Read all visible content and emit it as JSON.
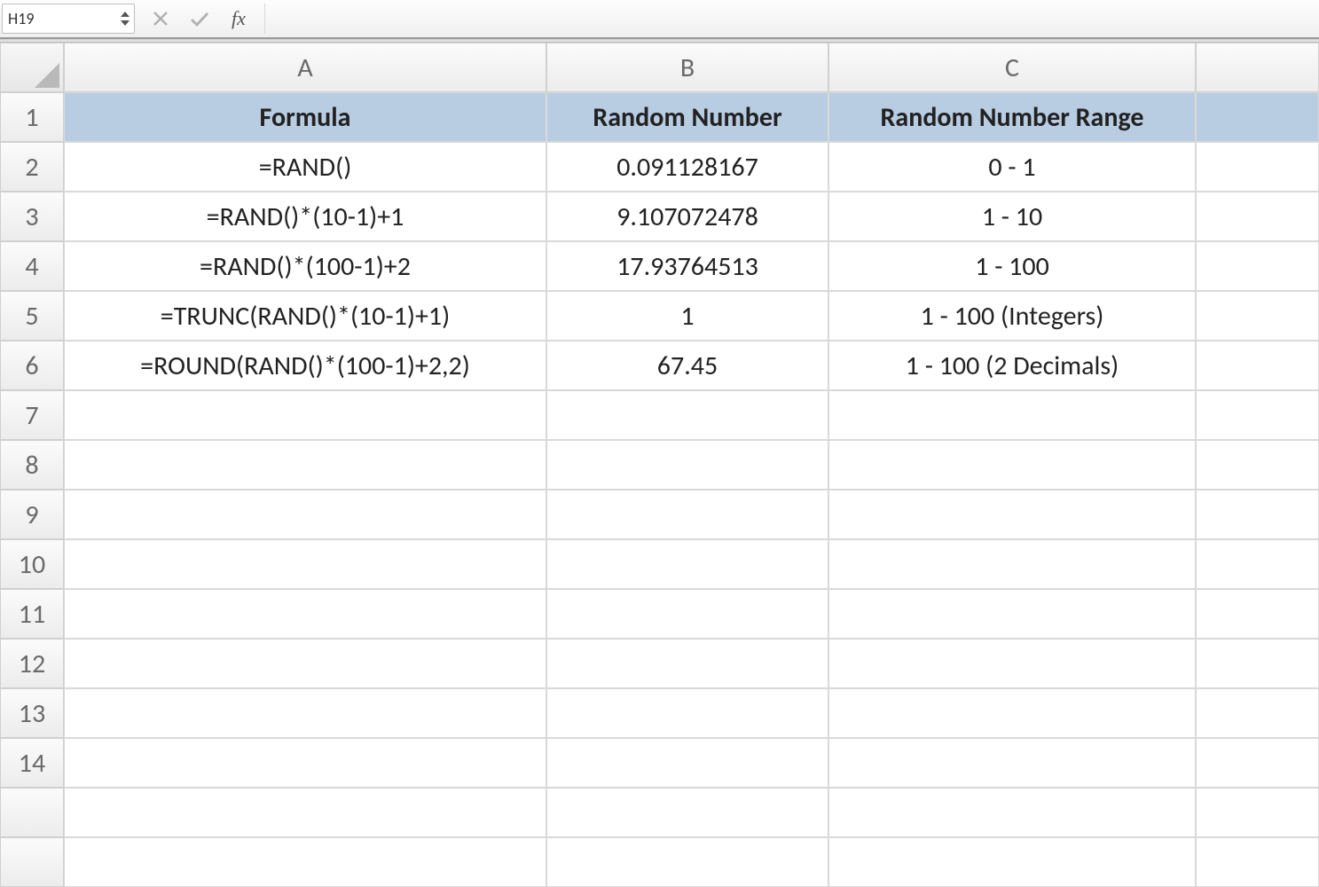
{
  "formula_bar": {
    "name_box_value": "H19",
    "fx_label": "fx",
    "formula_value": ""
  },
  "columns": [
    "A",
    "B",
    "C"
  ],
  "rows": [
    "1",
    "2",
    "3",
    "4",
    "5",
    "6",
    "7",
    "8",
    "9",
    "10",
    "11",
    "12",
    "13",
    "14"
  ],
  "header": {
    "A": "Formula",
    "B": "Random Number",
    "C": "Random Number Range"
  },
  "data": {
    "2": {
      "A": "=RAND()",
      "B": "0.091128167",
      "C": "0 - 1"
    },
    "3": {
      "A": "=RAND()*(10-1)+1",
      "B": "9.107072478",
      "C": "1 - 10"
    },
    "4": {
      "A": "=RAND()*(100-1)+2",
      "B": "17.93764513",
      "C": "1 - 100"
    },
    "5": {
      "A": "=TRUNC(RAND()*(10-1)+1)",
      "B": "1",
      "C": "1 - 100 (Integers)"
    },
    "6": {
      "A": "=ROUND(RAND()*(100-1)+2,2)",
      "B": "67.45",
      "C": "1 - 100 (2 Decimals)"
    }
  }
}
